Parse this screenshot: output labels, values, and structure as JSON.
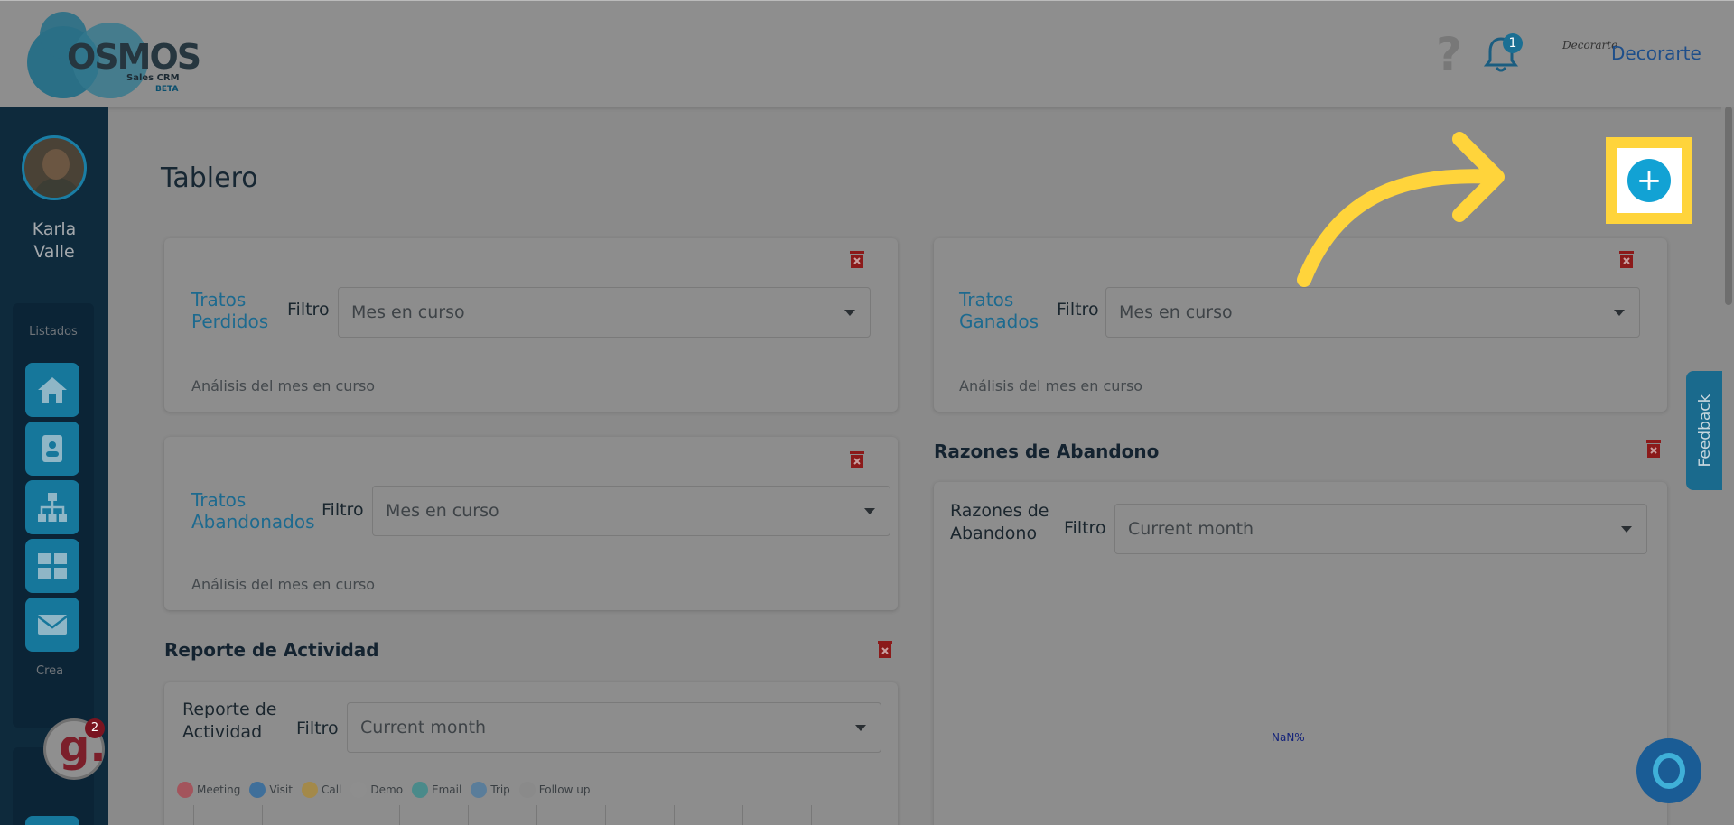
{
  "header": {
    "logo_text": "OSMOS",
    "logo_sub": "Sales CRM",
    "logo_beta": "BETA",
    "help_glyph": "?",
    "notification_count": "1",
    "company_logo_text": "Decorarte",
    "company_name": "Decorarte"
  },
  "sidebar": {
    "user_name_first": "Karla",
    "user_name_last": "Valle",
    "section_label": "Listados",
    "crea_label": "Crea",
    "nav_items": [
      "home-icon",
      "contacts-icon",
      "org-chart-icon",
      "dashboard-icon",
      "mail-icon"
    ],
    "g_widget_letter": "g.",
    "g_widget_badge": "2"
  },
  "main": {
    "title": "Tablero",
    "add_button_glyph": "+",
    "cards": {
      "perdidos": {
        "title": "Tratos Perdidos",
        "filter_label": "Filtro",
        "filter_value": "Mes en curso",
        "analysis": "Análisis del mes en curso"
      },
      "ganados": {
        "title": "Tratos Ganados",
        "filter_label": "Filtro",
        "filter_value": "Mes en curso",
        "analysis": "Análisis del mes en curso"
      },
      "abandonados": {
        "title": "Tratos Abandonados",
        "filter_label": "Filtro",
        "filter_value": "Mes en curso",
        "analysis": "Análisis del mes en curso"
      }
    },
    "razones": {
      "section_title": "Razones de Abandono",
      "card_title": "Razones de Abandono",
      "filter_label": "Filtro",
      "filter_value": "Current month",
      "chart_value": "NaN%"
    },
    "actividad": {
      "section_title": "Reporte de Actividad",
      "card_title": "Reporte de Actividad",
      "filter_label": "Filtro",
      "filter_value": "Current month",
      "legend": [
        {
          "label": "Meeting",
          "color": "#a3545c"
        },
        {
          "label": "Visit",
          "color": "#3f6f9a"
        },
        {
          "label": "Call",
          "color": "#a3894a"
        },
        {
          "label": "Demo",
          "color": "#8e8e8e"
        },
        {
          "label": "Email",
          "color": "#4a8a8a"
        },
        {
          "label": "Trip",
          "color": "#5a7d9a"
        },
        {
          "label": "Follow up",
          "color": "#8a8a8a"
        }
      ]
    }
  },
  "feedback_label": "Feedback",
  "colors": {
    "accent": "#12a2d4",
    "highlight": "#ffd43b",
    "trash": "#8b1a1a"
  }
}
